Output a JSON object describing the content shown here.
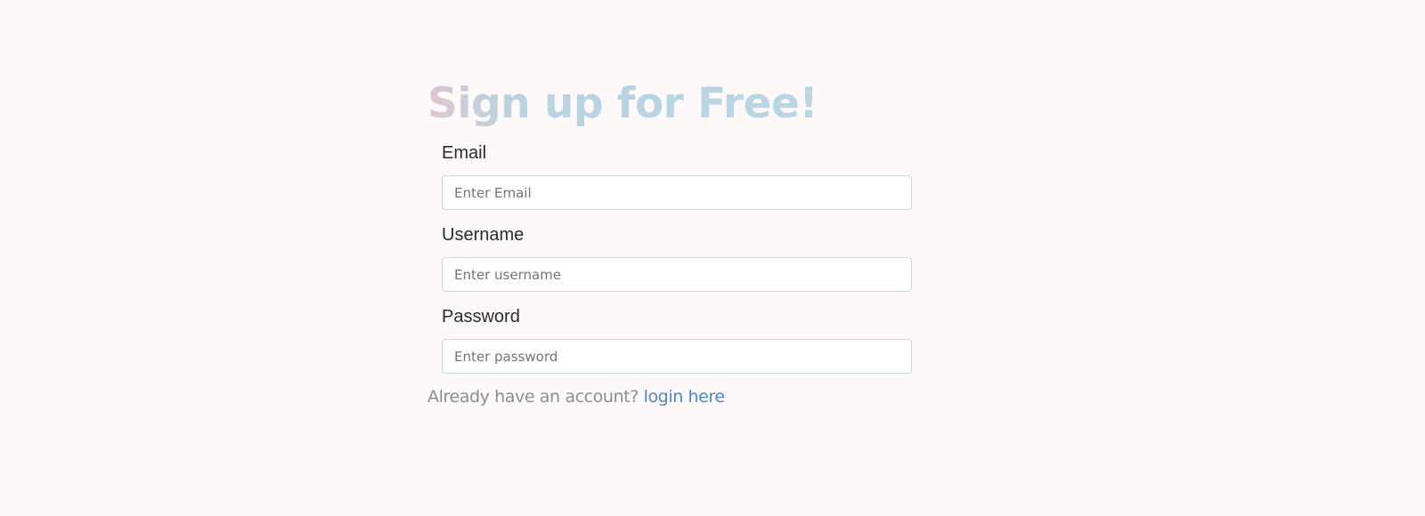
{
  "signup": {
    "title": "Sign up for Free!",
    "fields": [
      {
        "label": "Email",
        "placeholder": "Enter Email"
      },
      {
        "label": "Username",
        "placeholder": "Enter username"
      },
      {
        "label": "Password",
        "placeholder": "Enter password"
      }
    ],
    "login_prompt": "Already have an account?",
    "login_link": "login here"
  },
  "colors": {
    "background": "#fdf9f8",
    "title_gradient_start": "#e2c3cf",
    "title_gradient_end": "#b9d6e5",
    "link": "#4f86c6",
    "muted_text": "#8a8e93"
  }
}
